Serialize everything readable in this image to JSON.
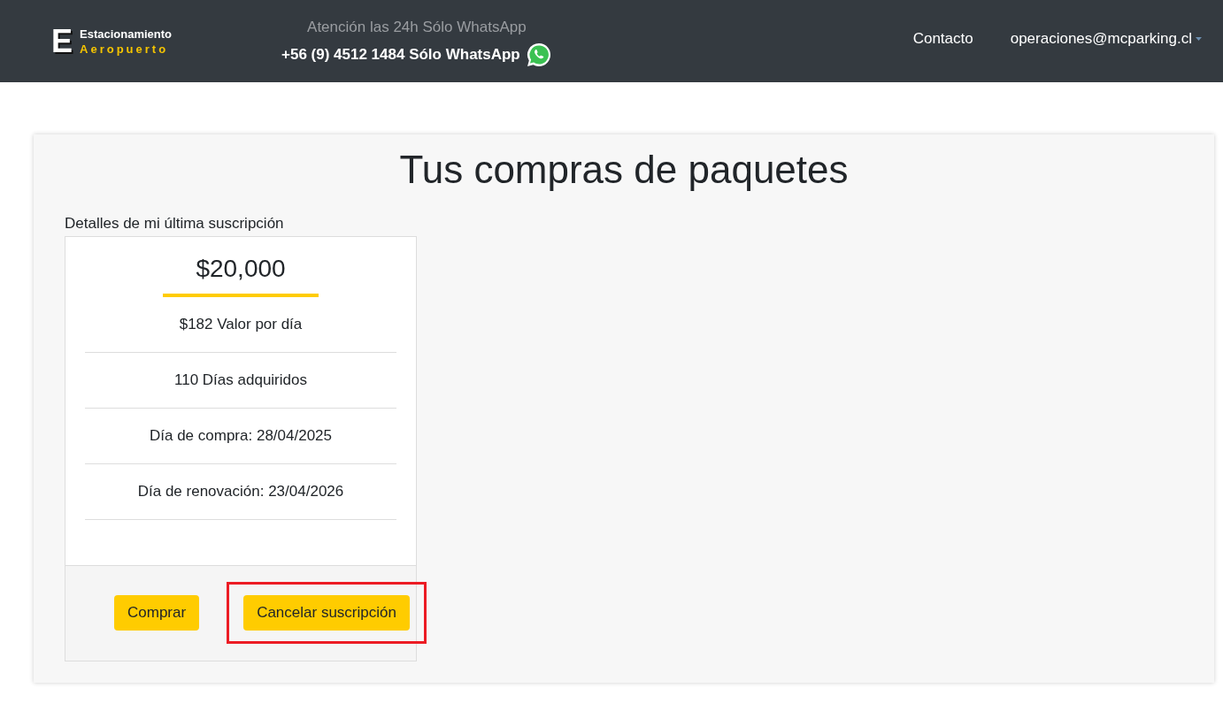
{
  "header": {
    "logo": {
      "letter": "E",
      "line_1": "Estacionamiento",
      "line_2": "Aeropuerto"
    },
    "notice": "Atención las 24h Sólo WhatsApp",
    "phone": "+56 (9) 4512 1484 Sólo WhatsApp",
    "nav": [
      {
        "label": "Contacto",
        "kind": "link"
      },
      {
        "label": "operaciones@mcparking.cl",
        "kind": "dropdown"
      }
    ]
  },
  "page": {
    "title": "Tus compras de paquetes",
    "subtitle": "Detalles de mi última suscripción",
    "package": {
      "price": "$20,000",
      "details": [
        "$182 Valor por día",
        "110 Días adquiridos",
        "Día de compra: 28/04/2025",
        "Día de renovación: 23/04/2026"
      ],
      "buttons": [
        {
          "label": "Comprar",
          "highlighted": false
        },
        {
          "label": "Cancelar suscripción",
          "highlighted": true
        }
      ]
    }
  }
}
